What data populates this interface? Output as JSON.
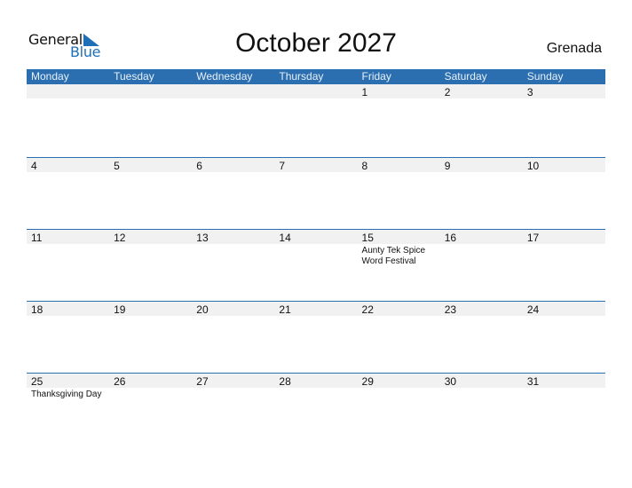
{
  "logo": {
    "word1": "General",
    "word2": "Blue"
  },
  "title": "October 2027",
  "country": "Grenada",
  "weekdays": [
    "Monday",
    "Tuesday",
    "Wednesday",
    "Thursday",
    "Friday",
    "Saturday",
    "Sunday"
  ],
  "weeks": [
    {
      "days": [
        {
          "num": "",
          "event": ""
        },
        {
          "num": "",
          "event": ""
        },
        {
          "num": "",
          "event": ""
        },
        {
          "num": "",
          "event": ""
        },
        {
          "num": "1",
          "event": ""
        },
        {
          "num": "2",
          "event": ""
        },
        {
          "num": "3",
          "event": ""
        }
      ]
    },
    {
      "days": [
        {
          "num": "4",
          "event": ""
        },
        {
          "num": "5",
          "event": ""
        },
        {
          "num": "6",
          "event": ""
        },
        {
          "num": "7",
          "event": ""
        },
        {
          "num": "8",
          "event": ""
        },
        {
          "num": "9",
          "event": ""
        },
        {
          "num": "10",
          "event": ""
        }
      ]
    },
    {
      "days": [
        {
          "num": "11",
          "event": ""
        },
        {
          "num": "12",
          "event": ""
        },
        {
          "num": "13",
          "event": ""
        },
        {
          "num": "14",
          "event": ""
        },
        {
          "num": "15",
          "event": "Aunty Tek Spice Word Festival"
        },
        {
          "num": "16",
          "event": ""
        },
        {
          "num": "17",
          "event": ""
        }
      ]
    },
    {
      "days": [
        {
          "num": "18",
          "event": ""
        },
        {
          "num": "19",
          "event": ""
        },
        {
          "num": "20",
          "event": ""
        },
        {
          "num": "21",
          "event": ""
        },
        {
          "num": "22",
          "event": ""
        },
        {
          "num": "23",
          "event": ""
        },
        {
          "num": "24",
          "event": ""
        }
      ]
    },
    {
      "days": [
        {
          "num": "25",
          "event": "Thanksgiving Day"
        },
        {
          "num": "26",
          "event": ""
        },
        {
          "num": "27",
          "event": ""
        },
        {
          "num": "28",
          "event": ""
        },
        {
          "num": "29",
          "event": ""
        },
        {
          "num": "30",
          "event": ""
        },
        {
          "num": "31",
          "event": ""
        }
      ]
    }
  ],
  "colors": {
    "accent": "#2c6fb0",
    "brand_blue": "#1f6fb8",
    "band": "#f1f1f1"
  }
}
